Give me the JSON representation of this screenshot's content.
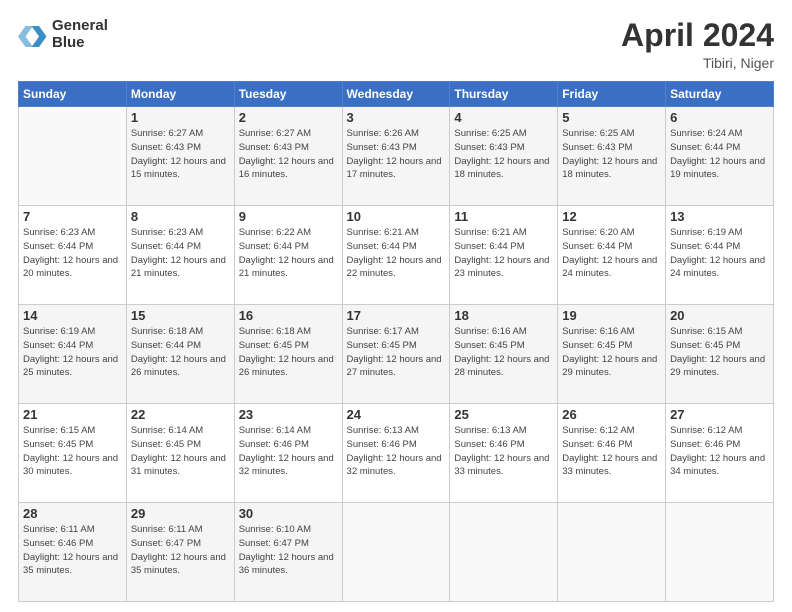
{
  "header": {
    "logo_line1": "General",
    "logo_line2": "Blue",
    "title": "April 2024",
    "location": "Tibiri, Niger"
  },
  "days_of_week": [
    "Sunday",
    "Monday",
    "Tuesday",
    "Wednesday",
    "Thursday",
    "Friday",
    "Saturday"
  ],
  "weeks": [
    [
      {
        "day": "",
        "info": ""
      },
      {
        "day": "1",
        "info": "Sunrise: 6:27 AM\nSunset: 6:43 PM\nDaylight: 12 hours\nand 15 minutes."
      },
      {
        "day": "2",
        "info": "Sunrise: 6:27 AM\nSunset: 6:43 PM\nDaylight: 12 hours\nand 16 minutes."
      },
      {
        "day": "3",
        "info": "Sunrise: 6:26 AM\nSunset: 6:43 PM\nDaylight: 12 hours\nand 17 minutes."
      },
      {
        "day": "4",
        "info": "Sunrise: 6:25 AM\nSunset: 6:43 PM\nDaylight: 12 hours\nand 18 minutes."
      },
      {
        "day": "5",
        "info": "Sunrise: 6:25 AM\nSunset: 6:43 PM\nDaylight: 12 hours\nand 18 minutes."
      },
      {
        "day": "6",
        "info": "Sunrise: 6:24 AM\nSunset: 6:44 PM\nDaylight: 12 hours\nand 19 minutes."
      }
    ],
    [
      {
        "day": "7",
        "info": "Sunrise: 6:23 AM\nSunset: 6:44 PM\nDaylight: 12 hours\nand 20 minutes."
      },
      {
        "day": "8",
        "info": "Sunrise: 6:23 AM\nSunset: 6:44 PM\nDaylight: 12 hours\nand 21 minutes."
      },
      {
        "day": "9",
        "info": "Sunrise: 6:22 AM\nSunset: 6:44 PM\nDaylight: 12 hours\nand 21 minutes."
      },
      {
        "day": "10",
        "info": "Sunrise: 6:21 AM\nSunset: 6:44 PM\nDaylight: 12 hours\nand 22 minutes."
      },
      {
        "day": "11",
        "info": "Sunrise: 6:21 AM\nSunset: 6:44 PM\nDaylight: 12 hours\nand 23 minutes."
      },
      {
        "day": "12",
        "info": "Sunrise: 6:20 AM\nSunset: 6:44 PM\nDaylight: 12 hours\nand 24 minutes."
      },
      {
        "day": "13",
        "info": "Sunrise: 6:19 AM\nSunset: 6:44 PM\nDaylight: 12 hours\nand 24 minutes."
      }
    ],
    [
      {
        "day": "14",
        "info": "Sunrise: 6:19 AM\nSunset: 6:44 PM\nDaylight: 12 hours\nand 25 minutes."
      },
      {
        "day": "15",
        "info": "Sunrise: 6:18 AM\nSunset: 6:44 PM\nDaylight: 12 hours\nand 26 minutes."
      },
      {
        "day": "16",
        "info": "Sunrise: 6:18 AM\nSunset: 6:45 PM\nDaylight: 12 hours\nand 26 minutes."
      },
      {
        "day": "17",
        "info": "Sunrise: 6:17 AM\nSunset: 6:45 PM\nDaylight: 12 hours\nand 27 minutes."
      },
      {
        "day": "18",
        "info": "Sunrise: 6:16 AM\nSunset: 6:45 PM\nDaylight: 12 hours\nand 28 minutes."
      },
      {
        "day": "19",
        "info": "Sunrise: 6:16 AM\nSunset: 6:45 PM\nDaylight: 12 hours\nand 29 minutes."
      },
      {
        "day": "20",
        "info": "Sunrise: 6:15 AM\nSunset: 6:45 PM\nDaylight: 12 hours\nand 29 minutes."
      }
    ],
    [
      {
        "day": "21",
        "info": "Sunrise: 6:15 AM\nSunset: 6:45 PM\nDaylight: 12 hours\nand 30 minutes."
      },
      {
        "day": "22",
        "info": "Sunrise: 6:14 AM\nSunset: 6:45 PM\nDaylight: 12 hours\nand 31 minutes."
      },
      {
        "day": "23",
        "info": "Sunrise: 6:14 AM\nSunset: 6:46 PM\nDaylight: 12 hours\nand 32 minutes."
      },
      {
        "day": "24",
        "info": "Sunrise: 6:13 AM\nSunset: 6:46 PM\nDaylight: 12 hours\nand 32 minutes."
      },
      {
        "day": "25",
        "info": "Sunrise: 6:13 AM\nSunset: 6:46 PM\nDaylight: 12 hours\nand 33 minutes."
      },
      {
        "day": "26",
        "info": "Sunrise: 6:12 AM\nSunset: 6:46 PM\nDaylight: 12 hours\nand 33 minutes."
      },
      {
        "day": "27",
        "info": "Sunrise: 6:12 AM\nSunset: 6:46 PM\nDaylight: 12 hours\nand 34 minutes."
      }
    ],
    [
      {
        "day": "28",
        "info": "Sunrise: 6:11 AM\nSunset: 6:46 PM\nDaylight: 12 hours\nand 35 minutes."
      },
      {
        "day": "29",
        "info": "Sunrise: 6:11 AM\nSunset: 6:47 PM\nDaylight: 12 hours\nand 35 minutes."
      },
      {
        "day": "30",
        "info": "Sunrise: 6:10 AM\nSunset: 6:47 PM\nDaylight: 12 hours\nand 36 minutes."
      },
      {
        "day": "",
        "info": ""
      },
      {
        "day": "",
        "info": ""
      },
      {
        "day": "",
        "info": ""
      },
      {
        "day": "",
        "info": ""
      }
    ]
  ]
}
